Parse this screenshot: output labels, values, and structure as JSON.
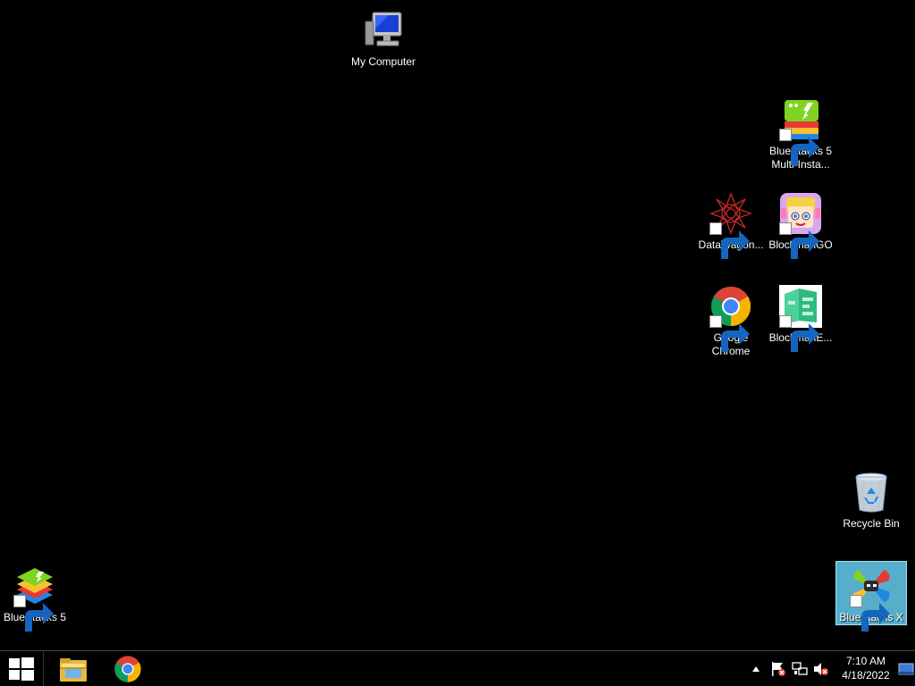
{
  "desktop": {
    "icons": {
      "my_computer": "My Computer",
      "bluestacks_multi_line1": "BlueStacks 5",
      "bluestacks_multi_line2": "Multi-Insta...",
      "datawagon": "DataWagon...",
      "blockmango": "BlockmanGO",
      "chrome_line1": "Google",
      "chrome_line2": "Chrome",
      "blockmane": "BlockmanE...",
      "recycle_bin": "Recycle Bin",
      "bluestacks5": "BlueStacks 5",
      "bluestacks_x": "BlueStacks X"
    },
    "selected_icon": "BlueStacks X"
  },
  "taskbar": {
    "clock_time": "7:10 AM",
    "clock_date": "4/18/2022"
  },
  "colors": {
    "desktop_bg": "#000000",
    "selection": "#66ccee",
    "taskbar_bg": "#000000"
  }
}
